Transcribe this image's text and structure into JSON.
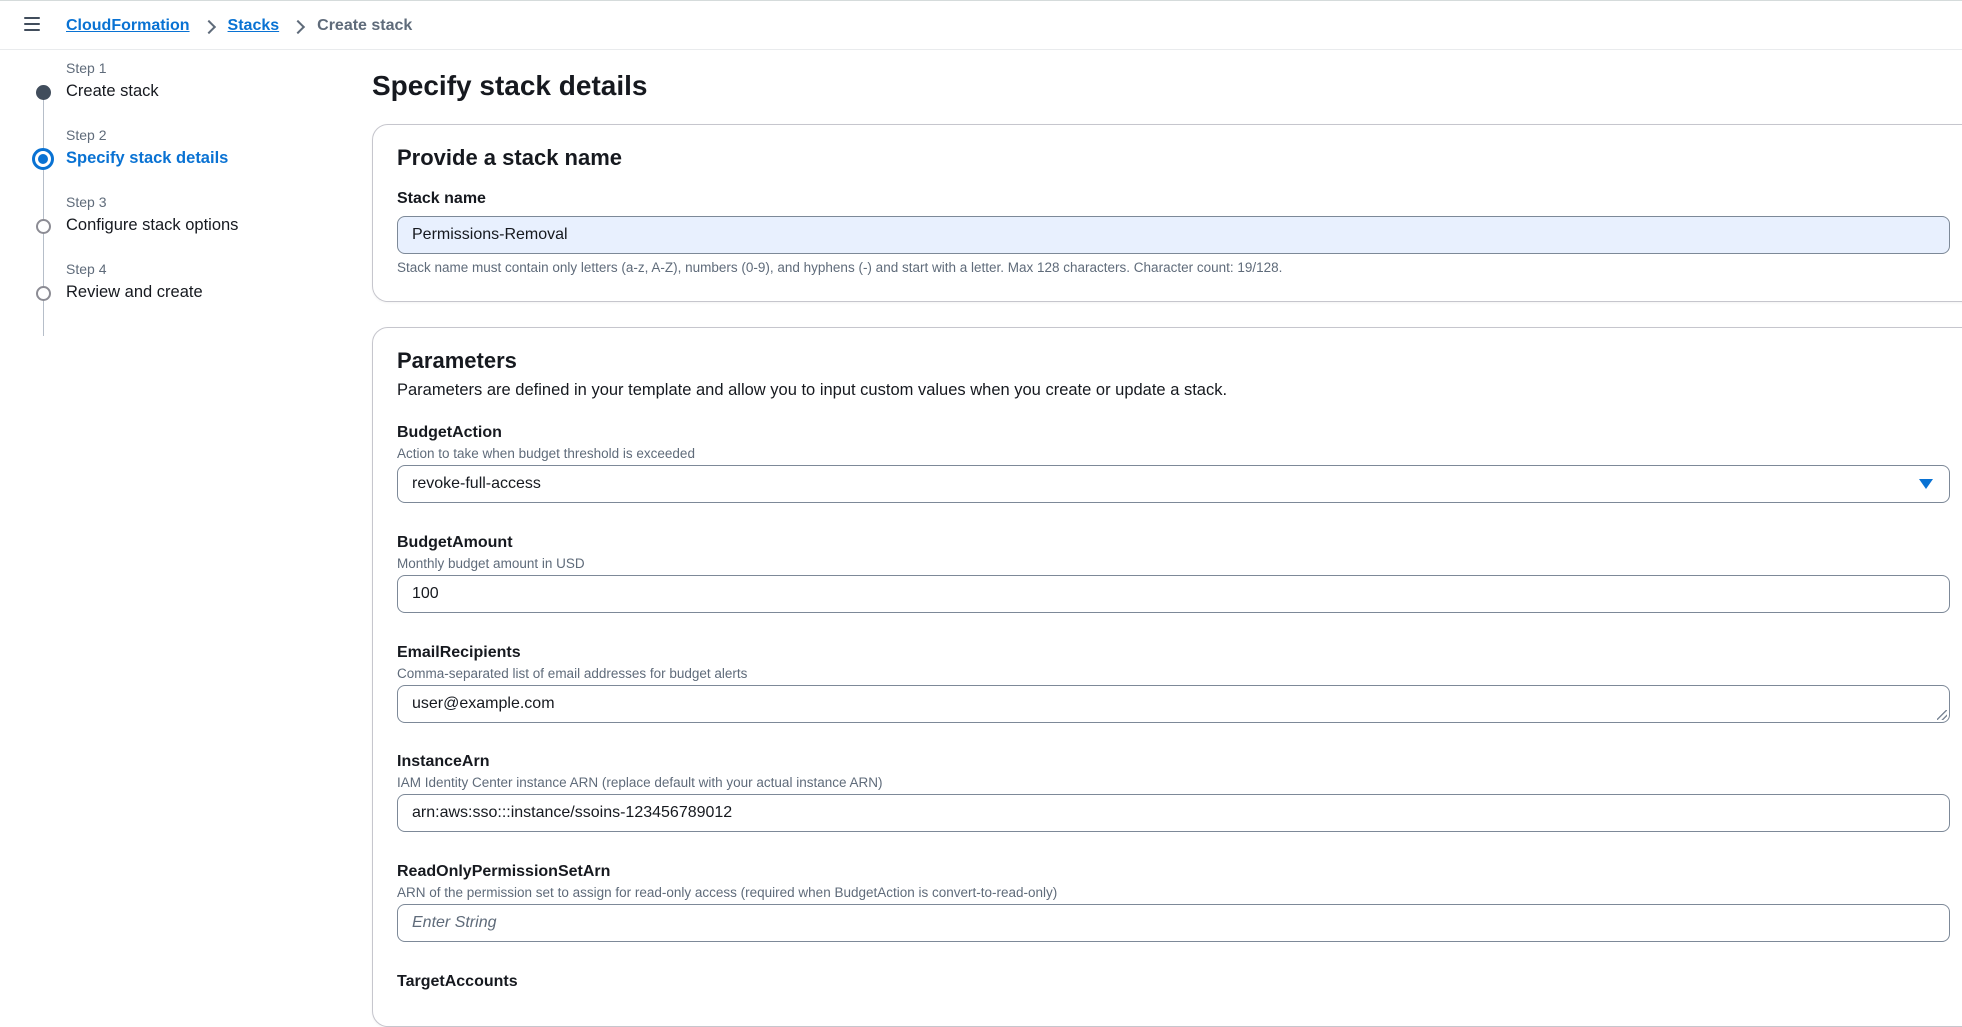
{
  "breadcrumb": {
    "items": [
      "CloudFormation",
      "Stacks"
    ],
    "current": "Create stack"
  },
  "steps": [
    {
      "number": "Step 1",
      "title": "Create stack",
      "state": "done"
    },
    {
      "number": "Step 2",
      "title": "Specify stack details",
      "state": "active"
    },
    {
      "number": "Step 3",
      "title": "Configure stack options",
      "state": "pending"
    },
    {
      "number": "Step 4",
      "title": "Review and create",
      "state": "pending"
    }
  ],
  "page_title": "Specify stack details",
  "stack_name_panel": {
    "header": "Provide a stack name",
    "label": "Stack name",
    "value": "Permissions-Removal",
    "hint": "Stack name must contain only letters (a-z, A-Z), numbers (0-9), and hyphens (-) and start with a letter. Max 128 characters. Character count: 19/128."
  },
  "parameters_panel": {
    "header": "Parameters",
    "description": "Parameters are defined in your template and allow you to input custom values when you create or update a stack.",
    "fields": [
      {
        "label": "BudgetAction",
        "description": "Action to take when budget threshold is exceeded",
        "value": "revoke-full-access",
        "type": "select"
      },
      {
        "label": "BudgetAmount",
        "description": "Monthly budget amount in USD",
        "value": "100",
        "type": "input"
      },
      {
        "label": "EmailRecipients",
        "description": "Comma-separated list of email addresses for budget alerts",
        "value": "user@example.com",
        "type": "textarea"
      },
      {
        "label": "InstanceArn",
        "description": "IAM Identity Center instance ARN (replace default with your actual instance ARN)",
        "value": "arn:aws:sso:::instance/ssoins-123456789012",
        "type": "input"
      },
      {
        "label": "ReadOnlyPermissionSetArn",
        "description": "ARN of the permission set to assign for read-only access (required when BudgetAction is convert-to-read-only)",
        "placeholder": "Enter String",
        "type": "input"
      },
      {
        "label": "TargetAccounts"
      }
    ]
  },
  "colors": {
    "link": "#0972d3",
    "text": "#16191f",
    "muted": "#5f6b7a",
    "autofill": "#e8f0fe"
  },
  "icons": {
    "menu": "hamburger-icon",
    "separator": "chevron-right-icon",
    "dropdown": "caret-down-icon"
  }
}
